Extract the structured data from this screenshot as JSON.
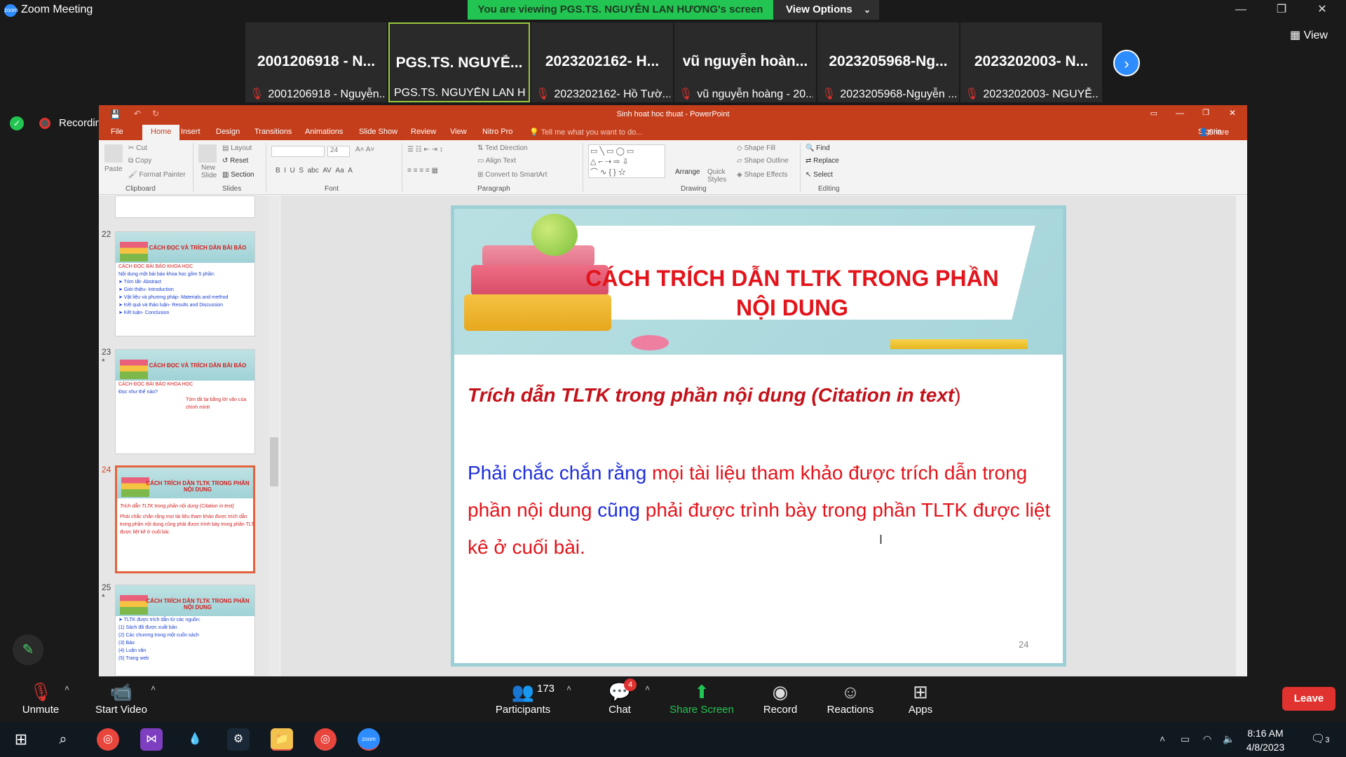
{
  "zoom": {
    "app_title": "Zoom Meeting",
    "viewing_banner": "You are viewing PGS.TS. NGUYỄN LAN HƯƠNG's screen",
    "view_options": "View Options",
    "view_button": "View",
    "recording": "Recording",
    "participants_tiles": [
      {
        "name": "2001206918 - N...",
        "label": "2001206918 - Nguyễn...",
        "muted": true
      },
      {
        "name": "PGS.TS. NGUYỄ...",
        "label": "PGS.TS. NGUYỄN LAN HƯ...",
        "muted": false,
        "active": true
      },
      {
        "name": "2023202162- H...",
        "label": "2023202162- Hồ Tườ...",
        "muted": true
      },
      {
        "name": "vũ nguyễn hoàn...",
        "label": "vũ nguyễn hoàng - 20...",
        "muted": true
      },
      {
        "name": "2023205968-Ng...",
        "label": "2023205968-Nguyễn ...",
        "muted": true
      },
      {
        "name": "2023202003- N...",
        "label": "2023202003- NGUYỄ...",
        "muted": true
      }
    ],
    "toolbar": {
      "unmute": "Unmute",
      "start_video": "Start Video",
      "participants": "Participants",
      "participants_count": "173",
      "chat": "Chat",
      "chat_badge": "4",
      "share_screen": "Share Screen",
      "record": "Record",
      "reactions": "Reactions",
      "apps": "Apps",
      "leave": "Leave"
    },
    "colors": {
      "accent_green": "#23c552",
      "blue": "#2d8cff",
      "leave_red": "#e0322e"
    }
  },
  "powerpoint": {
    "doc_title": "Sinh hoat hoc thuat - PowerPoint",
    "tabs": [
      "File",
      "Home",
      "Insert",
      "Design",
      "Transitions",
      "Animations",
      "Slide Show",
      "Review",
      "View",
      "Nitro Pro"
    ],
    "tell_me": "Tell me what you want to do...",
    "sign_in": "Sign in",
    "share": "Share",
    "ribbon": {
      "paste": "Paste",
      "cut": "Cut",
      "copy": "Copy",
      "format_painter": "Format Painter",
      "clipboard": "Clipboard",
      "new_slide": "New Slide",
      "layout": "Layout",
      "reset": "Reset",
      "section": "Section",
      "slides": "Slides",
      "font_size": "24",
      "font": "Font",
      "text_direction": "Text Direction",
      "align_text": "Align Text",
      "convert_smartart": "Convert to SmartArt",
      "paragraph": "Paragraph",
      "arrange": "Arrange",
      "quick_styles": "Quick Styles",
      "shape_fill": "Shape Fill",
      "shape_outline": "Shape Outline",
      "shape_effects": "Shape Effects",
      "drawing": "Drawing",
      "find": "Find",
      "replace": "Replace",
      "select": "Select",
      "editing": "Editing"
    },
    "thumbnails": [
      {
        "num": "22",
        "title": "CÁCH ĐỌC VÀ TRÍCH DẪN BÀI BÁO",
        "lines": [
          "CÁCH ĐỌC BÀI BÁO KHOA HỌC",
          "Nội dung một bài báo khoa học gồm 5 phần:",
          "➤ Tóm tắt- Abstract",
          "➤ Giới thiệu- Introduction",
          "➤ Vật liệu và phương pháp- Materials and method",
          "➤ Kết quả và thảo luận- Results and Discussion",
          "➤ Kết luận- Conclusion"
        ]
      },
      {
        "num": "23",
        "title": "CÁCH ĐỌC VÀ TRÍCH DẪN BÀI BÁO",
        "lines": [
          "CÁCH ĐỌC BÀI BÁO KHOA HỌC",
          "Đọc như thế nào?",
          "Tóm tắt lại bằng lời văn của chính mình"
        ]
      },
      {
        "num": "24",
        "title": "CÁCH TRÍCH DẪN TLTK TRONG PHẦN NỘI DUNG",
        "lines": [
          "Trích dẫn TLTK trong phần nội dung (Citation in text)",
          "Phải chắc chắn rằng mọi tài liệu tham khảo được trích dẫn",
          "trong phần nội dung cũng phải được trình bày trong phần TLTK",
          "được liệt kê ở cuối bài."
        ]
      },
      {
        "num": "25",
        "title": "CÁCH TRÍCH DẪN TLTK TRONG PHẦN NỘI DUNG",
        "lines": [
          "➤ TLTK được trích dẫn từ các nguồn:",
          "(1) Sách đã được xuất bản",
          "(2) Các chương trong một cuốn sách",
          "(3) Báo",
          "(4) Luận văn",
          "(5) Trang web"
        ]
      }
    ],
    "slide": {
      "title_line1": "CÁCH TRÍCH DẪN TLTK TRONG PHẦN",
      "title_line2": "NỘI DUNG",
      "subtitle": "Trích dẫn TLTK trong phần nội dung (Citation in text",
      "subtitle_close": ")",
      "p_blue1": "Phải chắc chắn rằng",
      "p_red1": " mọi tài liệu tham khảo được trích dẫn trong phần nội dung ",
      "p_blue2": "cũng",
      "p_red2": " phải được trình bày trong phần TLTK được liệt kê ở cuối bài.",
      "number": "24"
    }
  },
  "taskbar": {
    "time": "8:16 AM",
    "date": "4/8/2023",
    "notifications": "3"
  }
}
